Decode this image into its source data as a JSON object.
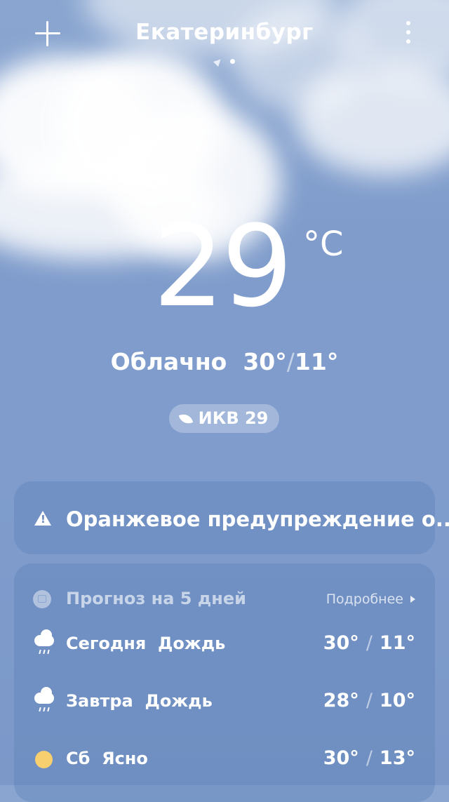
{
  "header": {
    "city": "Екатеринбург",
    "add_icon": "plus-icon",
    "menu_icon": "more-vertical-icon"
  },
  "current": {
    "temperature": "29",
    "unit": "°C",
    "condition": "Облачно",
    "high": "30°",
    "low": "11°",
    "separator": "/",
    "aqi_label": "ИКВ 29"
  },
  "warning": {
    "text": "Оранжевое предупреждение о..."
  },
  "forecast": {
    "title": "Прогноз на 5 дней",
    "more_label": "Подробнее",
    "days": [
      {
        "day": "Сегодня",
        "condition": "Дождь",
        "high": "30°",
        "low": "11°",
        "icon": "rain-icon"
      },
      {
        "day": "Завтра",
        "condition": "Дождь",
        "high": "28°",
        "low": "10°",
        "icon": "rain-icon"
      },
      {
        "day": "Сб",
        "condition": "Ясно",
        "high": "30°",
        "low": "13°",
        "icon": "sun-icon"
      }
    ]
  },
  "colors": {
    "sky": "#7f9ccb",
    "sun": "#f8cf6e"
  }
}
